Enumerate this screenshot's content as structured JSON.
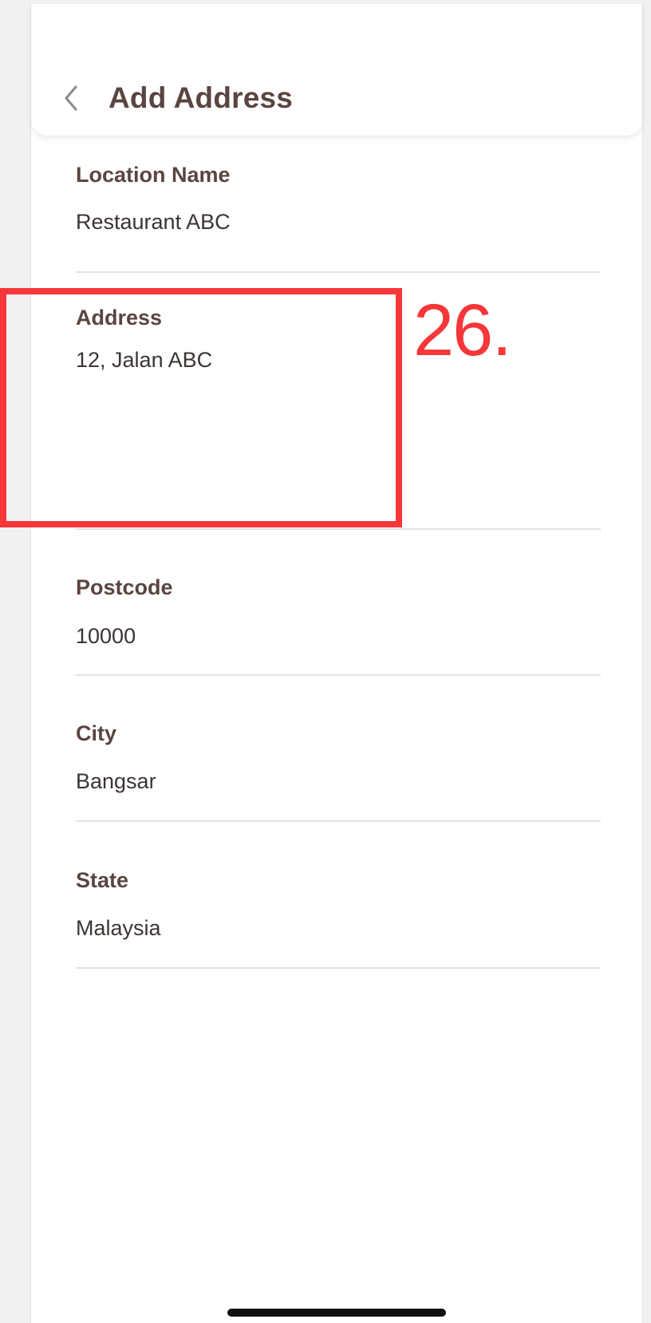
{
  "header": {
    "title": "Add Address",
    "back_icon": "chevron-left-icon"
  },
  "form": {
    "location_name": {
      "label": "Location Name",
      "value": "Restaurant ABC"
    },
    "address": {
      "label": "Address",
      "value": "12, Jalan ABC"
    },
    "postcode": {
      "label": "Postcode",
      "value": "10000"
    },
    "city": {
      "label": "City",
      "value": "Bangsar"
    },
    "state": {
      "label": "State",
      "value": "Malaysia"
    }
  },
  "annotation": {
    "label": "26.",
    "color": "#f63638"
  },
  "colors": {
    "text_brown": "#5a4540",
    "divider": "#e2e2e2"
  }
}
